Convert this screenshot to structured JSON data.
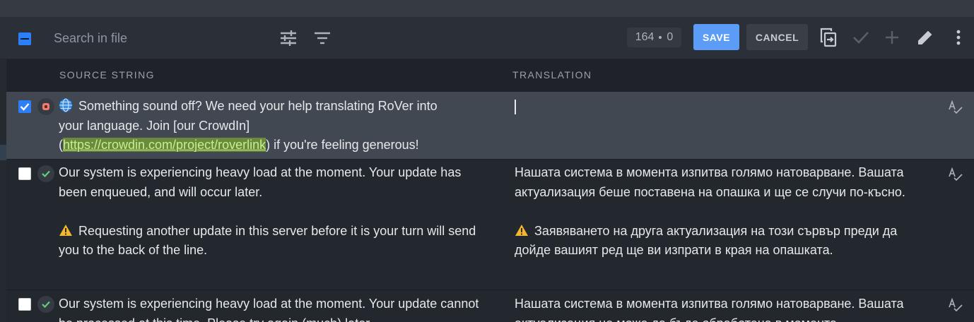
{
  "toolbar": {
    "search_placeholder": "Search in file",
    "counter_a": "164",
    "counter_b": "0",
    "save_label": "SAVE",
    "cancel_label": "CANCEL",
    "icons": [
      "filter-settings-icon",
      "filter-icon",
      "copy-source-icon",
      "check-icon",
      "plus-icon",
      "pencil-icon",
      "more-vert-icon"
    ]
  },
  "columns": {
    "source": "SOURCE STRING",
    "translation": "TRANSLATION"
  },
  "rows": [
    {
      "checked": true,
      "status": "untranslated",
      "source": {
        "pre": "Something sound off? We need your help translating RoVer into your language. Join [our CrowdIn](",
        "link": "https://crowdin.com/project/roverlink",
        "post": ") if you're feeling generous!"
      },
      "translation": ""
    },
    {
      "checked": false,
      "status": "translated",
      "source": {
        "p1": "Our system is experiencing heavy load at the moment. Your update has been enqueued, and will occur later.",
        "p2": "Requesting another update in this server before it is your turn will send you to the back of the line."
      },
      "translation": {
        "p1": "Нашата система в момента изпитва голямо натоварване. Вашата актуализация беше поставена на опашка и ще се случи по-късно.",
        "p2": "Заявяването на друга актуализация на този сървър преди да дойде вашият ред ще ви изпрати в края на опашката."
      }
    },
    {
      "checked": false,
      "status": "translated",
      "source": {
        "p1": "Our system is experiencing heavy load at the moment. Your update cannot be processed at this time. Please try again (much) later."
      },
      "translation": {
        "p1": "Нашата система в момента изпитва голямо натоварване. Вашата актуализация не може да бъде обработена в момента."
      }
    }
  ],
  "colors": {
    "accent": "#2d7ff9",
    "save": "#5c9cf6",
    "link_bg": "#6b8a3d",
    "link_fg": "#c6f08a",
    "status_ok": "#5fd07a",
    "status_untranslated": "#f07b6e"
  }
}
